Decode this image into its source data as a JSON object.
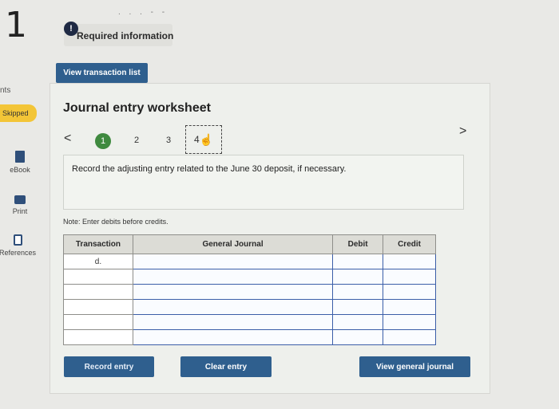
{
  "question_number": "1",
  "required_info": {
    "icon": "!",
    "label": "Required information"
  },
  "top_dots": ". . . - -",
  "view_transaction_list": "View transaction list",
  "sidebar": {
    "cut_label": "nts",
    "skipped": "Skipped",
    "items": [
      {
        "label": "eBook",
        "icon": "book-icon"
      },
      {
        "label": "Print",
        "icon": "print-icon"
      },
      {
        "label": "References",
        "icon": "references-icon"
      }
    ]
  },
  "worksheet": {
    "title": "Journal entry worksheet",
    "prev": "<",
    "next": ">",
    "steps": [
      "1",
      "2",
      "3",
      "4"
    ],
    "active_step": "1",
    "instruction": "Record the adjusting entry related to the June 30 deposit, if necessary.",
    "note": "Note: Enter debits before credits."
  },
  "table": {
    "headers": [
      "Transaction",
      "General Journal",
      "Debit",
      "Credit"
    ],
    "rows": [
      [
        "d.",
        "",
        "",
        ""
      ],
      [
        "",
        "",
        "",
        ""
      ],
      [
        "",
        "",
        "",
        ""
      ],
      [
        "",
        "",
        "",
        ""
      ],
      [
        "",
        "",
        "",
        ""
      ],
      [
        "",
        "",
        "",
        ""
      ]
    ]
  },
  "buttons": {
    "record_entry": "Record entry",
    "clear_entry": "Clear entry",
    "view_general_journal": "View general journal"
  },
  "colors": {
    "primary_button": "#2f5f8e",
    "skipped_badge": "#f3c537",
    "active_step": "#3f8a3f",
    "input_border": "#3b5ea8"
  }
}
